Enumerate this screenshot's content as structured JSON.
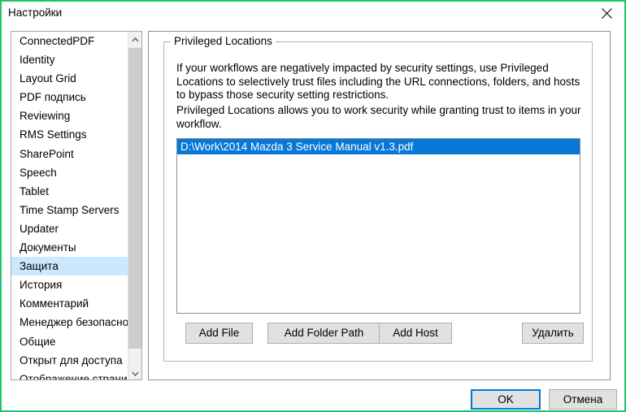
{
  "window": {
    "title": "Настройки",
    "border_color": "#1fc36b",
    "close_icon": "close-icon"
  },
  "sidebar": {
    "selected_index": 12,
    "items": [
      {
        "label": "ConnectedPDF"
      },
      {
        "label": "Identity"
      },
      {
        "label": "Layout Grid"
      },
      {
        "label": "PDF подпись"
      },
      {
        "label": "Reviewing"
      },
      {
        "label": "RMS Settings"
      },
      {
        "label": "SharePoint"
      },
      {
        "label": "Speech"
      },
      {
        "label": "Tablet"
      },
      {
        "label": "Time Stamp Servers"
      },
      {
        "label": "Updater"
      },
      {
        "label": "Документы"
      },
      {
        "label": "Защита"
      },
      {
        "label": "История"
      },
      {
        "label": "Комментарий"
      },
      {
        "label": "Менеджер безопаснос"
      },
      {
        "label": "Общие"
      },
      {
        "label": "Открыт для доступа"
      },
      {
        "label": "Отображение страниц"
      }
    ],
    "scrollbar": {
      "up_arrow_icon": "chevron-up-icon",
      "down_arrow_icon": "chevron-down-icon"
    },
    "selection_color": "#cbe8ff"
  },
  "main": {
    "group_title": "Privileged Locations",
    "description_1": "If your workflows are negatively impacted by security settings, use Privileged Locations to selectively trust files including the URL connections, folders, and hosts to bypass those security setting restrictions.",
    "description_2": "Privileged Locations allows you to work security while granting trust to items in your workflow.",
    "locations": [
      {
        "path": "D:\\Work\\2014 Mazda 3 Service Manual v1.3.pdf",
        "selected": true
      }
    ],
    "selection_color": "#0878d7",
    "buttons": {
      "add_file": "Add File",
      "add_folder_path": "Add Folder Path",
      "add_host": "Add Host",
      "remove": "Удалить"
    }
  },
  "footer": {
    "ok": "OK",
    "cancel": "Отмена",
    "focus_color": "#0078d7"
  }
}
